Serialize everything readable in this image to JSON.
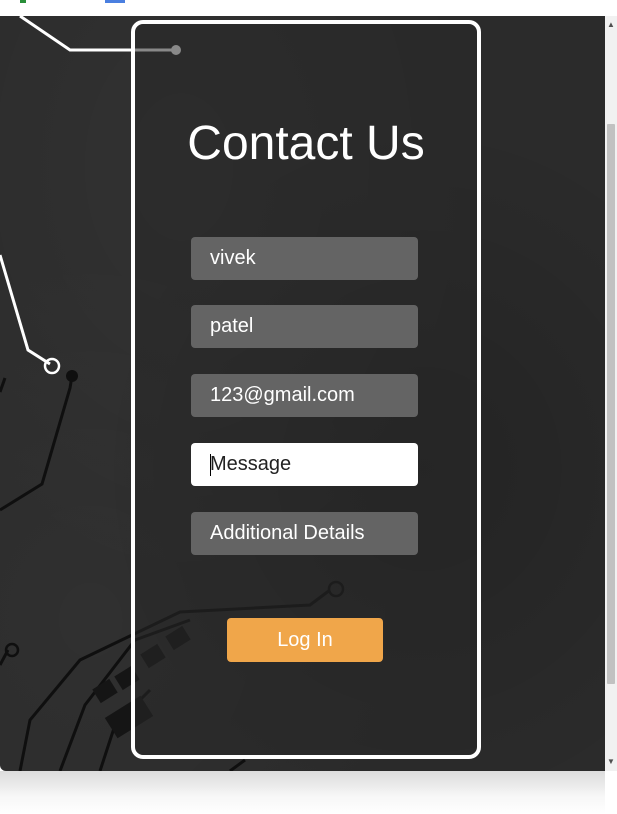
{
  "form": {
    "title": "Contact Us",
    "first_name": {
      "value": "vivek"
    },
    "last_name": {
      "value": "patel"
    },
    "email": {
      "value": "123@gmail.com"
    },
    "message": {
      "value": "",
      "placeholder": "Message"
    },
    "additional": {
      "value": "",
      "placeholder": "Additional Details"
    },
    "submit_label": "Log In"
  },
  "colors": {
    "background": "#2b2b2b",
    "field": "#646464",
    "button": "#f0a64a",
    "card_border": "#ffffff"
  },
  "scrollbar": {
    "up_icon": "▲",
    "down_icon": "▼"
  }
}
